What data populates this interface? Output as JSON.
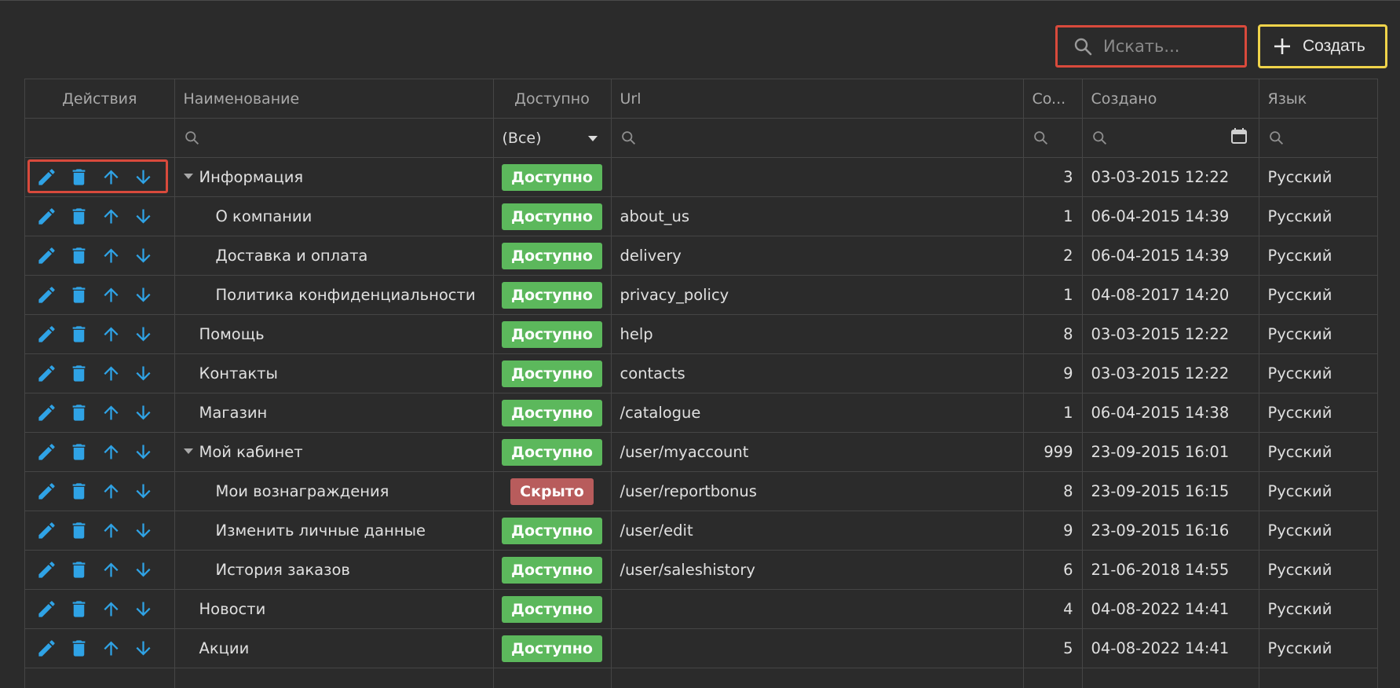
{
  "toolbar": {
    "search_placeholder": "Искать...",
    "create_label": "Создать"
  },
  "columns": {
    "actions": "Действия",
    "name": "Наименование",
    "available": "Доступно",
    "url": "Url",
    "count": "Co...",
    "created": "Создано",
    "language": "Язык"
  },
  "filters": {
    "available_value": "(Все)"
  },
  "colors": {
    "accent_icon": "#2fa3e6",
    "available": "#5cb85c",
    "hidden": "#b85c5c",
    "highlight_red": "#d94a3c",
    "highlight_yellow": "#efd34a"
  },
  "rows": [
    {
      "name": "Информация",
      "status": "Доступно",
      "url": "",
      "count": "3",
      "created": "03-03-2015 12:22",
      "lang": "Русский"
    },
    {
      "name": "О компании",
      "status": "Доступно",
      "url": "about_us",
      "count": "1",
      "created": "06-04-2015 14:39",
      "lang": "Русский"
    },
    {
      "name": "Доставка и оплата",
      "status": "Доступно",
      "url": "delivery",
      "count": "2",
      "created": "06-04-2015 14:39",
      "lang": "Русский"
    },
    {
      "name": "Политика конфиденциальности",
      "status": "Доступно",
      "url": "privacy_policy",
      "count": "1",
      "created": "04-08-2017 14:20",
      "lang": "Русский"
    },
    {
      "name": "Помощь",
      "status": "Доступно",
      "url": "help",
      "count": "8",
      "created": "03-03-2015 12:22",
      "lang": "Русский"
    },
    {
      "name": "Контакты",
      "status": "Доступно",
      "url": "contacts",
      "count": "9",
      "created": "03-03-2015 12:22",
      "lang": "Русский"
    },
    {
      "name": "Магазин",
      "status": "Доступно",
      "url": "/catalogue",
      "count": "1",
      "created": "06-04-2015 14:38",
      "lang": "Русский"
    },
    {
      "name": "Мой кабинет",
      "status": "Доступно",
      "url": "/user/myaccount",
      "count": "999",
      "created": "23-09-2015 16:01",
      "lang": "Русский"
    },
    {
      "name": "Мои вознаграждения",
      "status": "Скрыто",
      "url": "/user/reportbonus",
      "count": "8",
      "created": "23-09-2015 16:15",
      "lang": "Русский"
    },
    {
      "name": "Изменить личные данные",
      "status": "Доступно",
      "url": "/user/edit",
      "count": "9",
      "created": "23-09-2015 16:16",
      "lang": "Русский"
    },
    {
      "name": "История заказов",
      "status": "Доступно",
      "url": "/user/saleshistory",
      "count": "6",
      "created": "21-06-2018 14:55",
      "lang": "Русский"
    },
    {
      "name": "Новости",
      "status": "Доступно",
      "url": "",
      "count": "4",
      "created": "04-08-2022 14:41",
      "lang": "Русский"
    },
    {
      "name": "Акции",
      "status": "Доступно",
      "url": "",
      "count": "5",
      "created": "04-08-2022 14:41",
      "lang": "Русский"
    }
  ]
}
